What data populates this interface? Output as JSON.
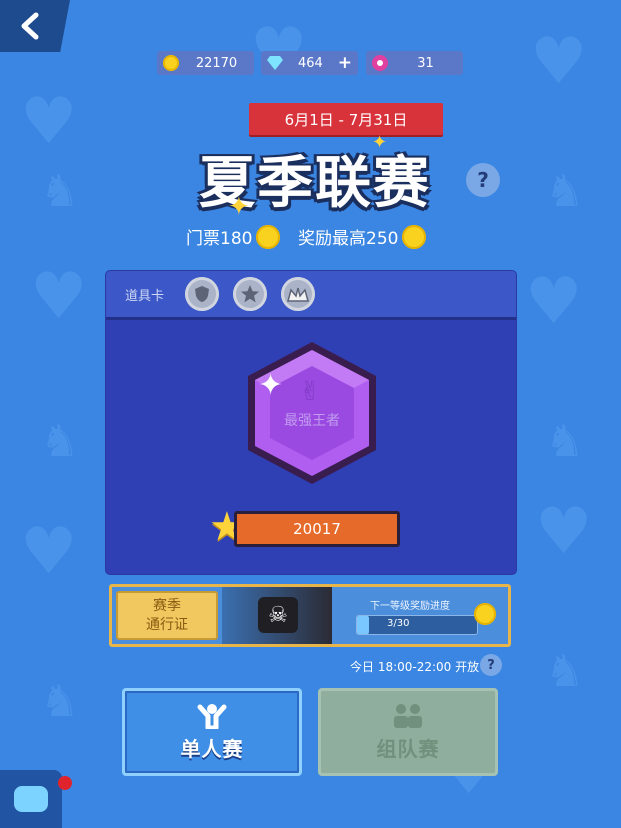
{
  "currencies": {
    "coins": "22170",
    "gems": "464",
    "gems_add": "+",
    "tokens": "31"
  },
  "event": {
    "date_range": "6月1日 - 7月31日",
    "title": "夏季联赛",
    "help": "?",
    "ticket_label": "门票180",
    "reward_label": "奖励最高250"
  },
  "tools": {
    "label": "道具卡",
    "items": [
      "shield-icon",
      "star-icon",
      "crown-icon"
    ]
  },
  "rank": {
    "name": "最强王者",
    "score": "20017"
  },
  "season_pass": {
    "title_line1": "赛季",
    "title_line2": "通行证",
    "progress_label": "下一等级奖励进度",
    "progress_text": "3/30",
    "progress": 0.1
  },
  "schedule": {
    "open_time": "今日 18:00-22:00 开放",
    "help": "?"
  },
  "modes": {
    "solo_label": "单人赛",
    "team_label": "组队赛"
  },
  "colors": {
    "background": "#3a86e2",
    "panel": "#2f3fb4",
    "date_banner": "#d8323a",
    "score_bar": "#e66a2a",
    "accent_gold": "#f8d21e"
  }
}
